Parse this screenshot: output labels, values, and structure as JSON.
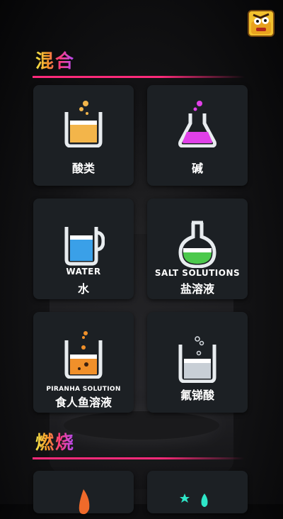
{
  "sections": {
    "mix": {
      "title": "混合"
    },
    "burn": {
      "title": "燃烧"
    }
  },
  "cards": [
    {
      "label": "酸类",
      "sub": ""
    },
    {
      "label": "碱",
      "sub": ""
    },
    {
      "label": "水",
      "sub": "WATER"
    },
    {
      "label": "盐溶液",
      "sub": "SALT SOLUTIONS"
    },
    {
      "label": "食人鱼溶液",
      "sub": "PIRANHA SOLUTION"
    },
    {
      "label": "氟锑酸",
      "sub": ""
    }
  ],
  "colors": {
    "accent_rule": "#ff2a7a",
    "card_bg": "#1c2024",
    "acid_liquid": "#f3b54a",
    "base_liquid": "#e040e8",
    "water_liquid": "#3aa0e8",
    "salt_liquid": "#4cc94c",
    "piranha_liquid": "#f0902a",
    "fluoro_liquid": "#d8dde2"
  },
  "icons": [
    "avatar-icon",
    "beaker-icon",
    "flask-icon",
    "pitcher-icon",
    "round-flask-icon",
    "flame-icon",
    "sparkle-drop-icon"
  ]
}
